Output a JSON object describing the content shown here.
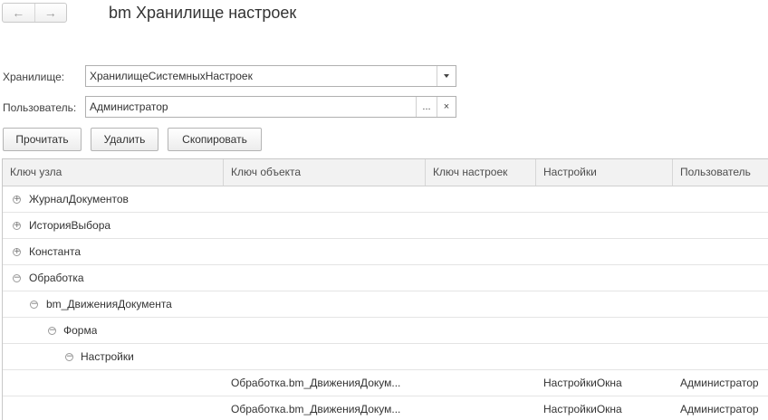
{
  "nav": {
    "back_glyph": "←",
    "forward_glyph": "→"
  },
  "title": "bm Хранилище настроек",
  "storage": {
    "label": "Хранилище:",
    "value": "ХранилищеСистемныхНастроек",
    "icon": "chevron-down-icon"
  },
  "user": {
    "label": "Пользователь:",
    "value": "Администратор",
    "select_glyph": "...",
    "clear_glyph": "×"
  },
  "buttons": {
    "read": "Прочитать",
    "delete": "Удалить",
    "copy": "Скопировать"
  },
  "grid": {
    "columns": [
      "Ключ узла",
      "Ключ объекта",
      "Ключ настроек",
      "Настройки",
      "Пользователь"
    ],
    "rows": [
      {
        "node": "ЖурналДокументов",
        "toggle": "⊕",
        "object": "",
        "settings_key": "",
        "settings": "",
        "user": ""
      },
      {
        "node": "ИсторияВыбора",
        "toggle": "⊕",
        "object": "",
        "settings_key": "",
        "settings": "",
        "user": ""
      },
      {
        "node": "Константа",
        "toggle": "⊕",
        "object": "",
        "settings_key": "",
        "settings": "",
        "user": ""
      },
      {
        "node": "Обработка",
        "toggle": "⊖",
        "object": "",
        "settings_key": "",
        "settings": "",
        "user": ""
      },
      {
        "node": "bm_ДвиженияДокумента",
        "toggle": "⊖",
        "object": "",
        "settings_key": "",
        "settings": "",
        "user": ""
      },
      {
        "node": "Форма",
        "toggle": "⊖",
        "object": "",
        "settings_key": "",
        "settings": "",
        "user": ""
      },
      {
        "node": "Настройки",
        "toggle": "⊖",
        "object": "",
        "settings_key": "",
        "settings": "",
        "user": ""
      },
      {
        "node": "",
        "toggle": "",
        "object": "Обработка.bm_ДвиженияДокум...",
        "settings_key": "",
        "settings": "НастройкиОкна",
        "user": "Администратор"
      },
      {
        "node": "",
        "toggle": "",
        "object": "Обработка.bm_ДвиженияДокум...",
        "settings_key": "",
        "settings": "НастройкиОкна",
        "user": "Администратор"
      }
    ]
  }
}
